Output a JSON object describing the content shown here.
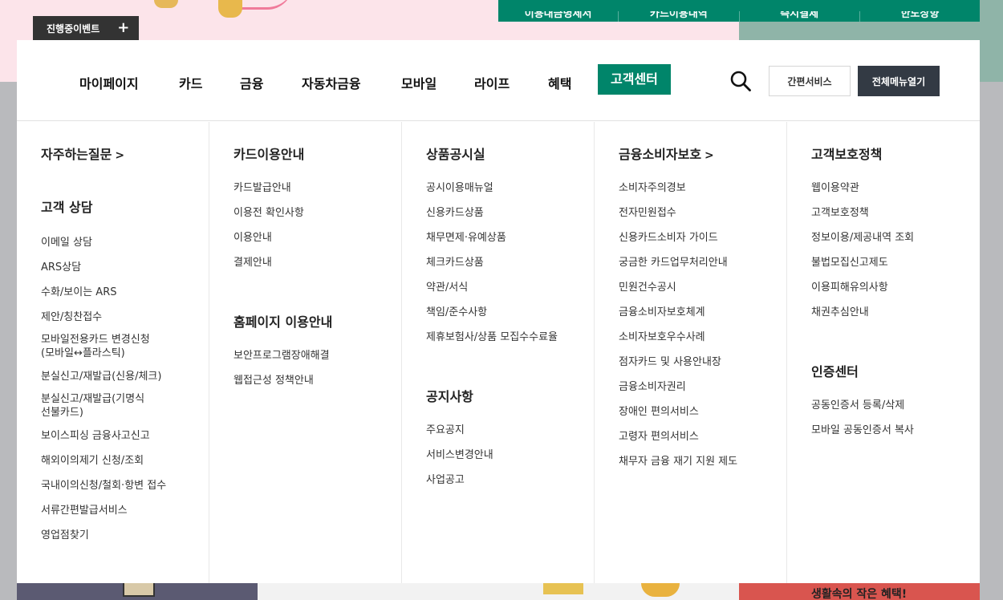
{
  "top_bar": {
    "links": [
      "이용내금명세서",
      "카드이용내역",
      "즉시결제",
      "한도상향"
    ],
    "event_button": "진행중이벤트",
    "event_icon": "plus-icon"
  },
  "gnb": {
    "items": [
      "마이페이지",
      "카드",
      "금융",
      "자동차금융",
      "모바일",
      "라이프",
      "혜택",
      "고객센터"
    ],
    "active_index": 7,
    "quick_service": "간편서비스",
    "all_menu": "전체메뉴열기",
    "accent_color": "#00856a"
  },
  "columns": [
    {
      "sections": [
        {
          "title": "자주하는질문",
          "has_arrow": true,
          "items": []
        },
        {
          "title": "고객 상담",
          "has_arrow": false,
          "items": [
            "이메일 상담",
            "ARS상담",
            "수화/보이는 ARS",
            "제안/칭찬접수",
            "모바일전용카드 변경신청",
            "(모바일↔플라스틱)",
            "분실신고/재발급(신용/체크)",
            "분실신고/재발급(기명식",
            "선불카드)",
            "보이스피싱 금융사고신고",
            "해외이의제기 신청/조회",
            "국내이의신청/철회·항변 접수",
            "서류간편발급서비스",
            "영업점찾기"
          ]
        }
      ]
    },
    {
      "sections": [
        {
          "title": "카드이용안내",
          "has_arrow": false,
          "items": [
            "카드발급안내",
            "이용전 확인사항",
            "이용안내",
            "결제안내"
          ]
        },
        {
          "title": "홈페이지 이용안내",
          "has_arrow": false,
          "items": [
            "보안프로그램장애해결",
            "웹접근성 정책안내"
          ]
        }
      ]
    },
    {
      "sections": [
        {
          "title": "상품공시실",
          "has_arrow": false,
          "items": [
            "공시이용매뉴얼",
            "신용카드상품",
            "채무면제·유예상품",
            "체크카드상품",
            "약관/서식",
            "책임/준수사항",
            "제휴보험사/상품 모집수수료율"
          ]
        },
        {
          "title": "공지사항",
          "has_arrow": false,
          "items": [
            "주요공지",
            "서비스변경안내",
            "사업공고"
          ]
        }
      ]
    },
    {
      "sections": [
        {
          "title": "금융소비자보호",
          "has_arrow": true,
          "items": [
            "소비자주의경보",
            "전자민원접수",
            "신용카드소비자 가이드",
            "궁금한 카드업무처리안내",
            "민원건수공시",
            "금융소비자보호체계",
            "소비자보호우수사례",
            "점자카드 및 사용안내장",
            "금융소비자권리",
            "장애인 편의서비스",
            "고령자 편의서비스",
            "채무자 금융 재기 지원 제도"
          ]
        }
      ]
    },
    {
      "sections": [
        {
          "title": "고객보호정책",
          "has_arrow": false,
          "items": [
            "웹이용약관",
            "고객보호정책",
            "정보이용/제공내역 조회",
            "불법모집신고제도",
            "이용피해유의사항",
            "채권추심안내"
          ]
        },
        {
          "title": "인증센터",
          "has_arrow": false,
          "items": [
            "공동인증서 등록/삭제",
            "모바일 공동인증서 복사"
          ]
        }
      ]
    }
  ],
  "bottom_banner": {
    "text": "생활속의 작은 혜택!"
  }
}
